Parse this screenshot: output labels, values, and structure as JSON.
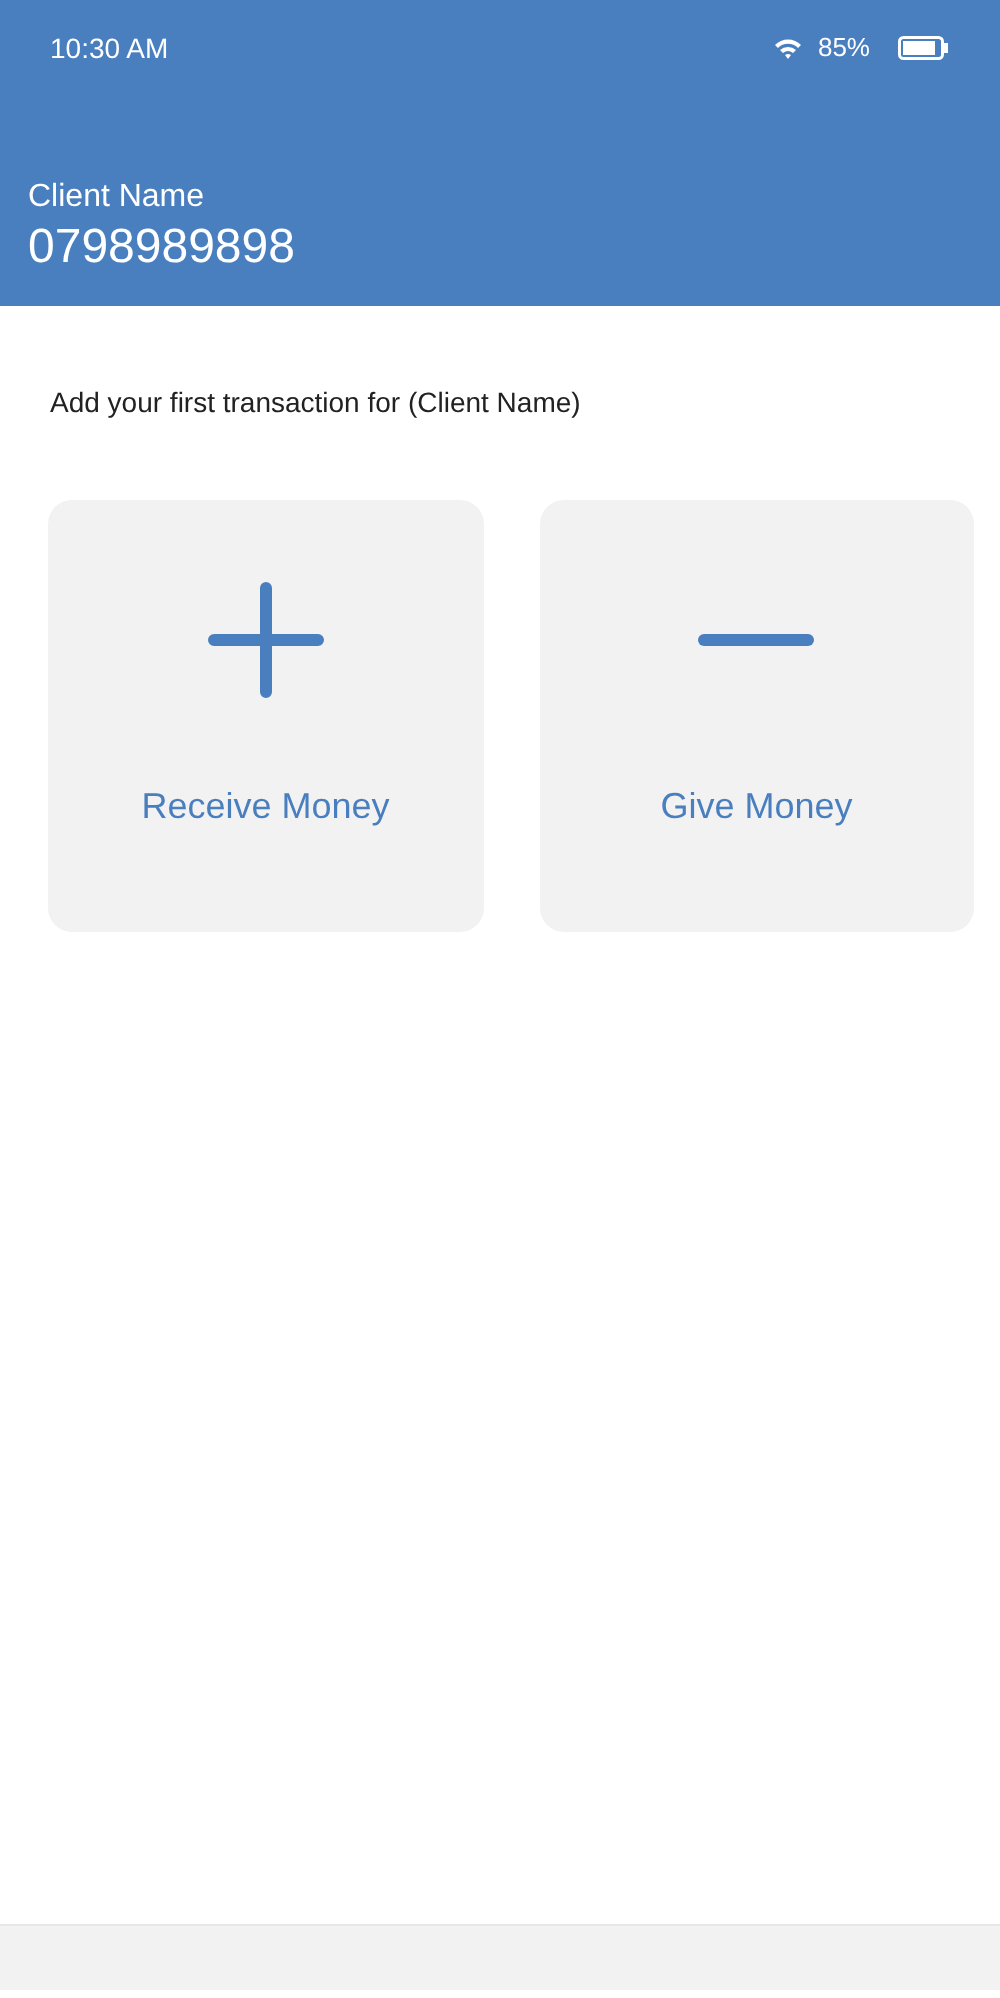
{
  "status_bar": {
    "time": "10:30 AM",
    "battery": "85%"
  },
  "header": {
    "name": "Client Name",
    "phone": "0798989898"
  },
  "prompt": "Add your first transaction for (Client Name)",
  "actions": [
    {
      "kind": "plus",
      "label": "Receive Money"
    },
    {
      "kind": "minus",
      "label": "Give Money"
    }
  ]
}
